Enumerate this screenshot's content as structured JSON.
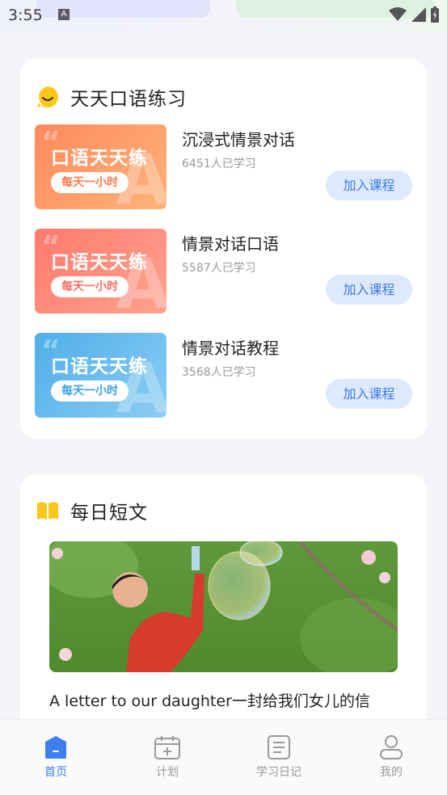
{
  "status_bar": {
    "time": "3:55",
    "notification_badge": "A"
  },
  "speaking_section": {
    "title": "天天口语练习",
    "courses": [
      {
        "thumb_title": "口语天天练",
        "thumb_tag": "每天一小时",
        "name": "沉浸式情景对话",
        "learners": "6451人已学习",
        "button": "加入课程"
      },
      {
        "thumb_title": "口语天天练",
        "thumb_tag": "每天一小时",
        "name": "情景对话口语",
        "learners": "5587人已学习",
        "button": "加入课程"
      },
      {
        "thumb_title": "口语天天练",
        "thumb_tag": "每天一小时",
        "name": "情景对话教程",
        "learners": "3568人已学习",
        "button": "加入课程"
      }
    ]
  },
  "daily_article": {
    "title": "每日短文",
    "article_title": "A letter to our daughter一封给我们女儿的信"
  },
  "tabbar": {
    "tabs": [
      {
        "label": "首页",
        "icon": "home-icon",
        "active": true
      },
      {
        "label": "计划",
        "icon": "calendar-icon",
        "active": false
      },
      {
        "label": "学习日记",
        "icon": "notebook-icon",
        "active": false
      },
      {
        "label": "我的",
        "icon": "user-icon",
        "active": false
      }
    ]
  },
  "colors": {
    "accent": "#3d7ff0",
    "button_bg": "#dde9fd",
    "title_icon": "#ffc61a"
  }
}
